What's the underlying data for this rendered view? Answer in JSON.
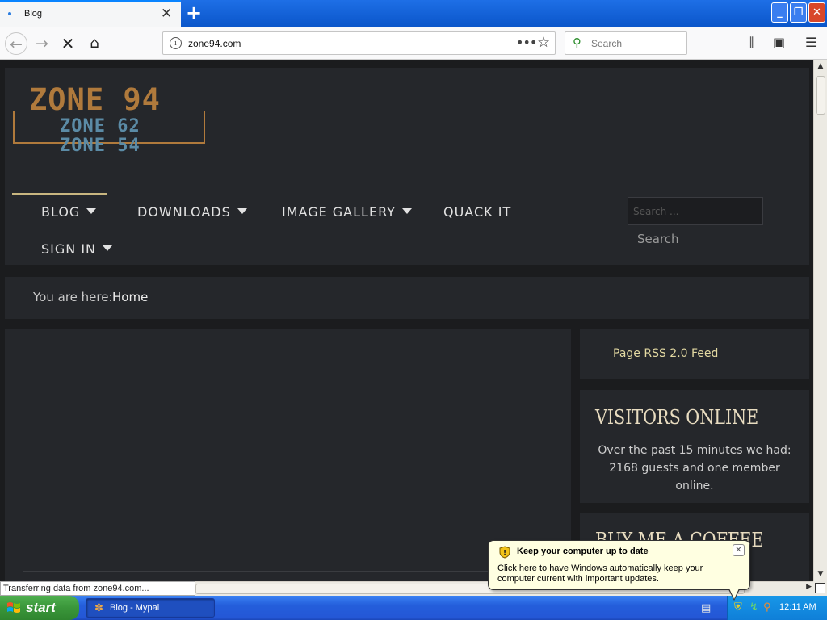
{
  "browser": {
    "tab_title": "Blog",
    "tab_close": "✕",
    "new_tab": "+",
    "url": "zone94.com",
    "search_placeholder": "Search",
    "win_min": "_",
    "win_max": "❐",
    "win_close": "✕",
    "icons": [
      "back-arrow-icon",
      "forward-arrow-icon",
      "stop-icon",
      "home-icon",
      "info-icon",
      "page-actions-icon",
      "bookmark-star-icon",
      "search-icon",
      "library-icon",
      "sidebar-icon",
      "menu-icon"
    ]
  },
  "site": {
    "logo": {
      "line1": "ZONE 94",
      "line2": "ZONE 62",
      "line3": "ZONE 54"
    },
    "menu": [
      {
        "label": "BLOG",
        "caret": true,
        "active": true
      },
      {
        "label": "DOWNLOADS",
        "caret": true
      },
      {
        "label": "IMAGE GALLERY",
        "caret": true
      },
      {
        "label": "QUACK IT",
        "caret": false
      },
      {
        "label": "SIGN IN",
        "caret": true
      }
    ],
    "search_placeholder": "Search ...",
    "search_button": "Search",
    "breadcrumb": {
      "label": "You are here:",
      "current": "Home"
    },
    "sidebar": {
      "rss": "Page RSS 2.0 Feed",
      "visitors_title": "VISITORS ONLINE",
      "visitors_text": "Over the past 15 minutes we had: 2168 guests and one member online.",
      "coffee_title": "BUY ME A COFFEE"
    },
    "colors": {
      "active_line": "#c8b680",
      "rss_link": "#e3d9a2",
      "heading": "#e8dcc0",
      "logo_gold": "#b07a3c",
      "logo_blue": "#5b8ba6"
    }
  },
  "status": {
    "text": "Transferring data from zone94.com..."
  },
  "taskbar": {
    "start": "start",
    "task": "Blog - Mypal",
    "clock": "12:11 AM"
  },
  "balloon": {
    "title": "Keep your computer up to date",
    "body": "Click here to have Windows automatically keep your computer current with important updates.",
    "close": "✕"
  }
}
